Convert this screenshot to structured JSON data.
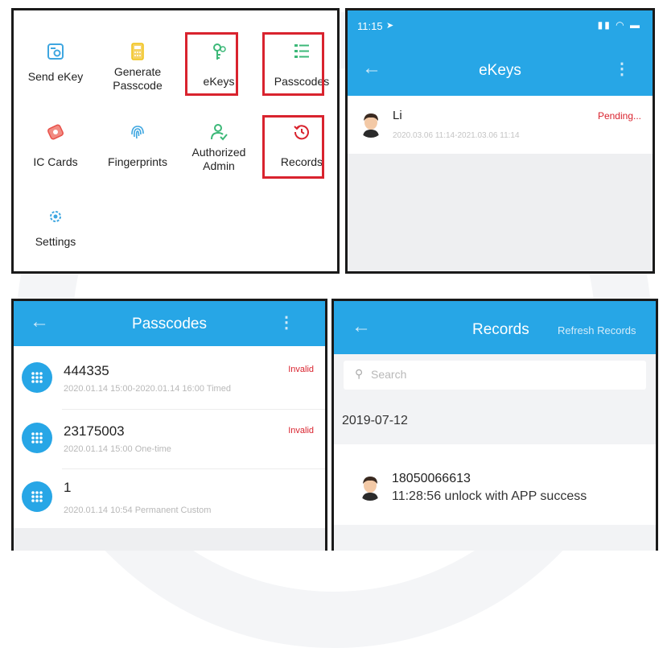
{
  "menu": {
    "items": [
      {
        "label_lines": [
          "Send eKey"
        ],
        "icon": "send-ekey-icon"
      },
      {
        "label_lines": [
          "Generate",
          "Passcode"
        ],
        "icon": "generate-passcode-icon"
      },
      {
        "label_lines": [
          "eKeys"
        ],
        "icon": "ekeys-icon"
      },
      {
        "label_lines": [
          "Passcodes"
        ],
        "icon": "passcodes-icon"
      },
      {
        "label_lines": [
          "IC Cards"
        ],
        "icon": "ic-cards-icon"
      },
      {
        "label_lines": [
          "Fingerprints"
        ],
        "icon": "fingerprints-icon"
      },
      {
        "label_lines": [
          "Authorized",
          "Admin"
        ],
        "icon": "authorized-admin-icon"
      },
      {
        "label_lines": [
          "Records"
        ],
        "icon": "records-icon"
      },
      {
        "label_lines": [
          "Settings"
        ],
        "icon": "settings-icon"
      }
    ]
  },
  "ekeys": {
    "status_time": "11:15",
    "title": "eKeys",
    "entry": {
      "name": "Li",
      "period": "2020.03.06 11:14-2021.03.06 11:14",
      "status": "Pending..."
    }
  },
  "passcodes": {
    "title": "Passcodes",
    "items": [
      {
        "code": "444335",
        "detail": "2020.01.14 15:00-2020.01.14 16:00   Timed",
        "status": "Invalid"
      },
      {
        "code": "23175003",
        "detail": "2020.01.14 15:00   One-time",
        "status": "Invalid"
      },
      {
        "code": "1",
        "detail": "2020.01.14 10:54 Permanent  Custom",
        "status": ""
      }
    ]
  },
  "records": {
    "title": "Records",
    "refresh_label": "Refresh Records",
    "search_placeholder": "Search",
    "date": "2019-07-12",
    "entry": {
      "user": "18050066613",
      "action": "11:28:56 unlock with APP success"
    }
  },
  "colors": {
    "accent": "#27a6e6",
    "highlight": "#d9232e",
    "icon_green": "#3cb878",
    "icon_yellow": "#f0c419",
    "icon_red": "#e8514a",
    "icon_blue": "#3ea6e0"
  }
}
